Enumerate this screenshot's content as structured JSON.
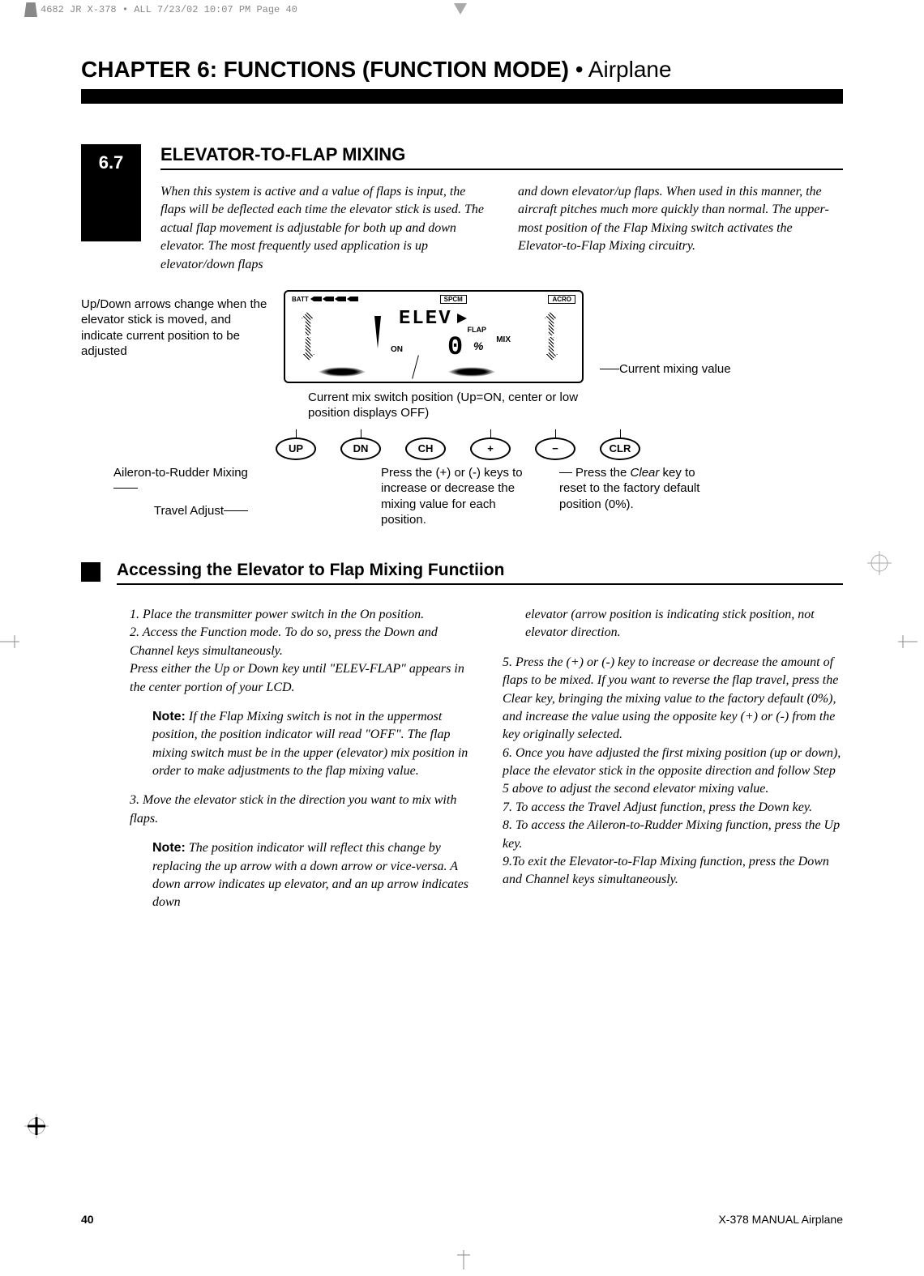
{
  "header": {
    "job_info": "4682 JR X-378 • ALL  7/23/02  10:07 PM  Page 40"
  },
  "chapter": {
    "title_bold": "CHAPTER 6: FUNCTIONS (FUNCTION MODE) ",
    "title_light": "• Airplane"
  },
  "section": {
    "number": "6.7",
    "title": "ELEVATOR-TO-FLAP MIXING",
    "intro_left": "When this system is active and a value of flaps is input, the flaps will be deflected each time the elevator stick is used. The actual flap movement is adjustable for both up and down elevator. The most frequently used application is up elevator/down flaps",
    "intro_right": "and down elevator/up flaps. When used in this manner, the aircraft pitches much more quickly than normal. The upper-most position of the Flap Mixing switch activates the Elevator-to-Flap Mixing circuitry."
  },
  "diagram": {
    "left_label": "Up/Down arrows change when the elevator stick is moved, and indicate current position to be adjusted",
    "lcd": {
      "batt": "BATT",
      "spcm": "SPCM",
      "acro": "ACRO",
      "elev": "ELEV",
      "flap": "FLAP",
      "mix": "MIX",
      "on": "ON",
      "value": "0",
      "pct": "%"
    },
    "right_label": "Current mixing value",
    "mid_label": "Current mix switch position (Up=ON, center or low position displays OFF)",
    "buttons": {
      "up": "UP",
      "dn": "DN",
      "ch": "CH",
      "plus": "+",
      "minus": "−",
      "clr": "CLR"
    },
    "bottom": {
      "aileron": "Aileron-to-Rudder Mixing",
      "travel": "Travel Adjust",
      "press_inc": "Press the (+) or (-) keys to increase or decrease the mixing value for each position.",
      "press_clr_1": "Press the ",
      "press_clr_em": "Clear",
      "press_clr_2": " key to reset to the factory default position (0%)."
    }
  },
  "subsection": {
    "title": "Accessing the Elevator to Flap Mixing Functiion",
    "col1": {
      "p1": "1. Place the transmitter power switch in the On position.",
      "p2a": "2. Access the Function mode. To do so, press the ",
      "p2b": "Down",
      "p2c": " and ",
      "p2d": "Channel",
      "p2e": " keys simultaneously.",
      "p3a": "Press either the ",
      "p3b": "Up",
      "p3c": " or ",
      "p3d": "Down",
      "p3e": " key until \"ELEV-FLAP\" appears in the center portion of your LCD.",
      "note1_label": "Note:",
      "note1": " If the Flap Mixing switch is not in the uppermost position, the position indicator will read \"OFF\". The flap mixing switch must be in the upper (elevator) mix position in order to make adjustments to the flap mixing value.",
      "p4": "3. Move the elevator stick in the direction you want to mix with flaps.",
      "note2_label": "Note:",
      "note2": " The position indicator will reflect this change by replacing the up arrow with a down arrow or vice-versa. A down arrow indicates up elevator, and an up arrow indicates down"
    },
    "col2": {
      "cont": "elevator (arrow position is indicating stick position, not elevator direction.",
      "p5a": "5. Press the (+) or (-) key to increase or decrease the amount of flaps to be mixed. If you want to reverse the flap travel, press the ",
      "p5b": "Clear",
      "p5c": " key, bringing the mixing value to the factory default (0%), and increase the value using the opposite key (+) or (-) from the key originally selected.",
      "p6": "6. Once you have adjusted the first mixing position (up or down), place the elevator stick in the opposite direction and follow Step 5 above to adjust the second elevator mixing value.",
      "p7": "7. To access the Travel Adjust function, press the Down key.",
      "p8a": "8. To access the Aileron-to-Rudder Mixing function, press the ",
      "p8b": "Up",
      "p8c": " key.",
      "p9a": "9.To exit the Elevator-to-Flap Mixing function, press the ",
      "p9b": "Down",
      "p9c": " and ",
      "p9d": "Channel",
      "p9e": " keys simultaneously."
    }
  },
  "footer": {
    "page": "40",
    "manual": "X-378  MANUAL Airplane"
  }
}
